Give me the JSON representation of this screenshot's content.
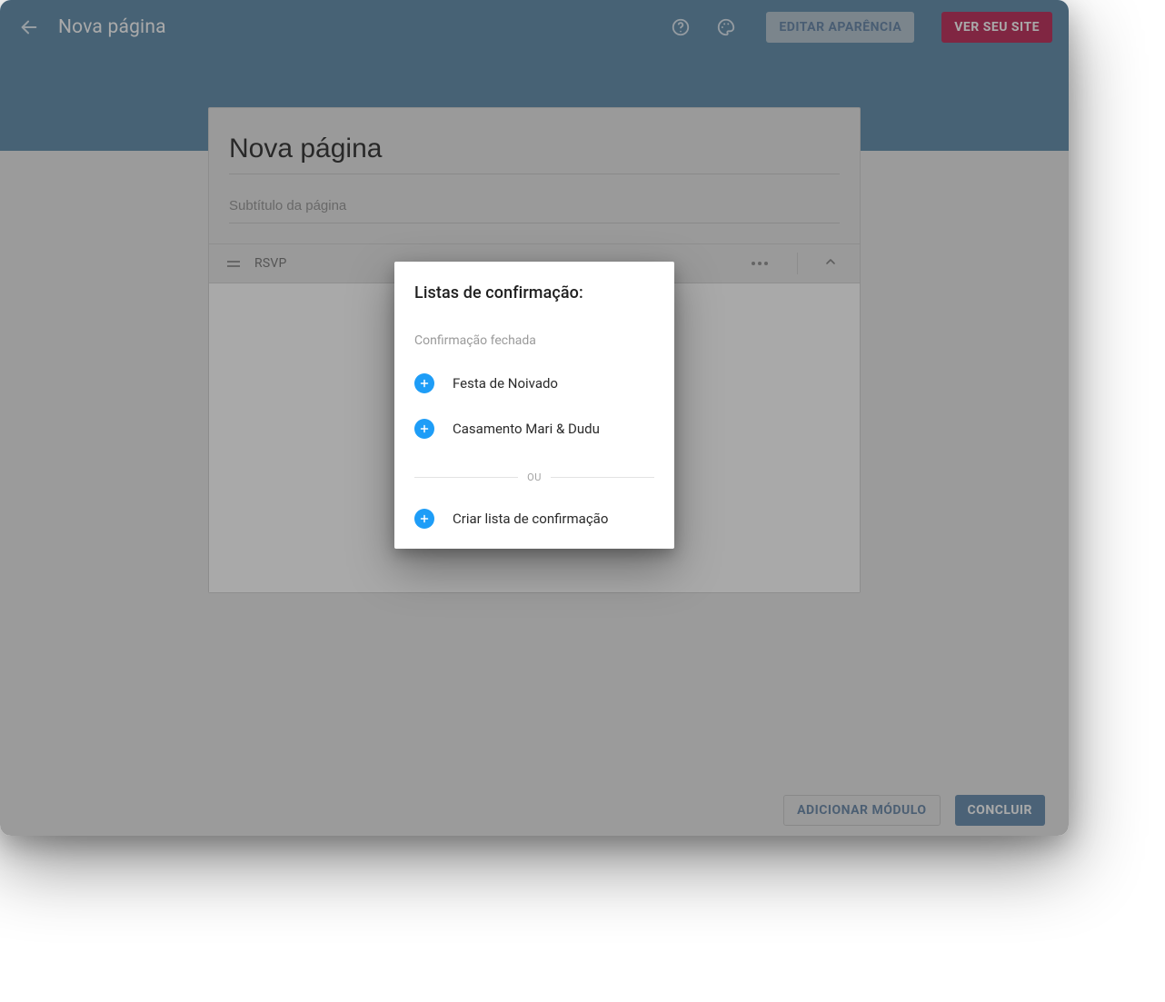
{
  "toolbar": {
    "page_title_small": "Nova página",
    "edit_appearance_label": "EDITAR APARÊNCIA",
    "view_site_label": "VER SEU SITE"
  },
  "editor": {
    "title_value": "Nova página",
    "subtitle_placeholder": "Subtítulo da página",
    "module_label": "RSVP"
  },
  "footer": {
    "add_module_label": "ADICIONAR MÓDULO",
    "done_label": "CONCLUIR"
  },
  "modal": {
    "title": "Listas de confirmação:",
    "closed_label": "Confirmação fechada",
    "options": [
      {
        "label": "Festa de Noivado"
      },
      {
        "label": "Casamento Mari & Dudu"
      }
    ],
    "or_label": "OU",
    "create_label": "Criar lista de confirmação"
  }
}
